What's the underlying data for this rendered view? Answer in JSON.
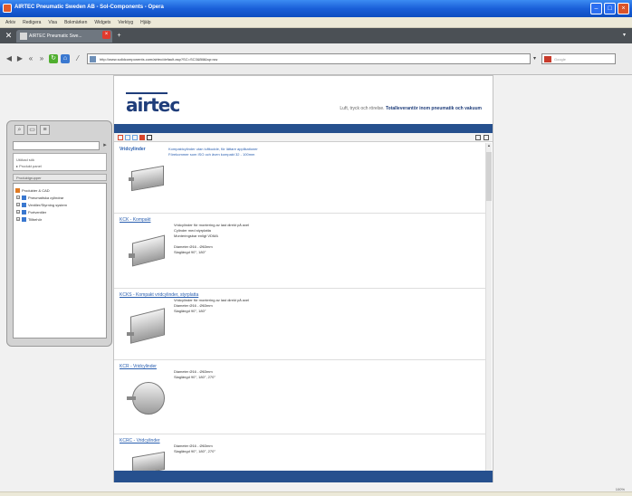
{
  "window": {
    "title": "AIRTEC Pneumatic Sweden AB - Sol-Components - Opera"
  },
  "menubar": {
    "items": [
      "Arkiv",
      "Redigera",
      "Visa",
      "Bokmärken",
      "Widgets",
      "Verktyg",
      "Hjälp"
    ]
  },
  "tabbar": {
    "tab_label": "AIRTEC Pneumatic Swe..."
  },
  "addressbar": {
    "url": "http://www.solidcomponents.com/airtec/default.asp?SC=SC3&Blå&sp=sw",
    "search_placeholder": "Google"
  },
  "leftpanel": {
    "search_value": "",
    "list_items": [
      "Utökad sök",
      "▸ Produkt panel"
    ],
    "header": "Produktgrupper",
    "tree": [
      {
        "label": "Produkter & CAD",
        "root": true
      },
      {
        "label": "Pneumatiska cylindrar"
      },
      {
        "label": "Ventiler/Styrning system"
      },
      {
        "label": "Portventiler"
      },
      {
        "label": "Tillbehör"
      }
    ]
  },
  "page": {
    "logo": "airtec",
    "tagline_plain": "Luft, tryck och rörelse. ",
    "tagline_bold": "Totalleverantör inom pneumatik och vakuum"
  },
  "products": [
    {
      "name": "Vridcylinder",
      "desc": "Kompaktcylinder utan luftkudde, för lättare applikationer\nFörekommer som ISO och även kompakt 32 - 100mm",
      "blue": true
    },
    {
      "name": "KCK - Kompakt",
      "desc": "Vridcylinder för montering av last direkt på axel\nCylinder med styrplatta\nMonteringsbar enligt VDMA\n\nDiameter Ø16 - Ø63mm\nSlaglängd 90°, 180°",
      "blue": false
    },
    {
      "name": "KCKS - Kompakt vridcylinder, styrplatta",
      "desc": "Vridcylinder för montering av last direkt på axel\nDiameter Ø16 - Ø63mm\nSlaglängd 90°, 180°",
      "blue": false
    },
    {
      "name": "KCR - Vridcylinder",
      "desc": "Diameter Ø16 - Ø63mm\nSlaglängd 90°, 180°, 270°",
      "blue": false
    },
    {
      "name": "KCRC - Vridcylinder",
      "desc": "Diameter Ø16 - Ø63mm\nSlaglängd 90°, 180°, 270°",
      "blue": false
    }
  ],
  "status": {
    "zoom": "100%"
  },
  "colors": {
    "brand": "#1f3d7a",
    "band": "#26508e",
    "link": "#2a5fb0"
  }
}
